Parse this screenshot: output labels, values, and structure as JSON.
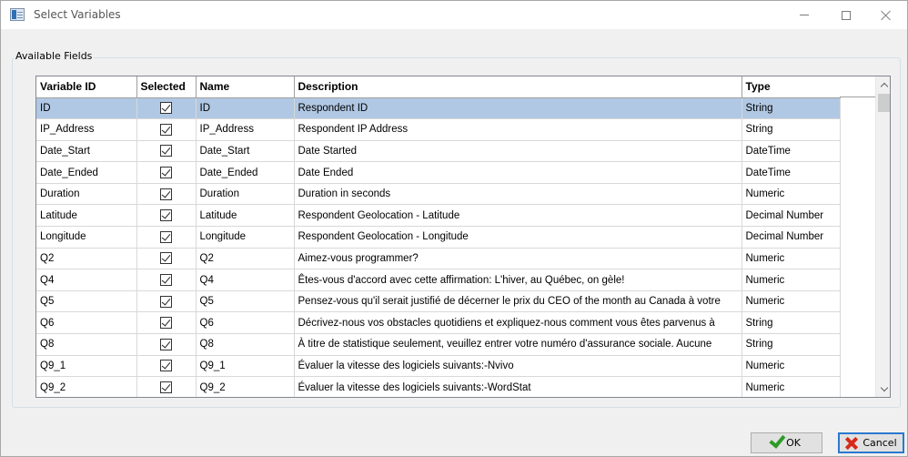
{
  "window": {
    "title": "Select Variables",
    "icon": "app-window-icon"
  },
  "group": {
    "label": "Available Fields"
  },
  "table": {
    "columns": [
      "Variable ID",
      "Selected",
      "Name",
      "Description",
      "Type"
    ],
    "rows": [
      {
        "variable_id": "ID",
        "selected": true,
        "name": "ID",
        "description": "Respondent ID",
        "type": "String"
      },
      {
        "variable_id": "IP_Address",
        "selected": true,
        "name": "IP_Address",
        "description": "Respondent IP Address",
        "type": "String"
      },
      {
        "variable_id": "Date_Start",
        "selected": true,
        "name": "Date_Start",
        "description": "Date Started",
        "type": "DateTime"
      },
      {
        "variable_id": "Date_Ended",
        "selected": true,
        "name": "Date_Ended",
        "description": "Date Ended",
        "type": "DateTime"
      },
      {
        "variable_id": "Duration",
        "selected": true,
        "name": "Duration",
        "description": "Duration in seconds",
        "type": "Numeric"
      },
      {
        "variable_id": "Latitude",
        "selected": true,
        "name": "Latitude",
        "description": "Respondent Geolocation - Latitude",
        "type": "Decimal Number"
      },
      {
        "variable_id": "Longitude",
        "selected": true,
        "name": "Longitude",
        "description": "Respondent Geolocation - Longitude",
        "type": "Decimal Number"
      },
      {
        "variable_id": "Q2",
        "selected": true,
        "name": "Q2",
        "description": "Aimez-vous programmer?",
        "type": "Numeric"
      },
      {
        "variable_id": "Q4",
        "selected": true,
        "name": "Q4",
        "description": "Êtes-vous d'accord avec cette affirmation: L'hiver, au Québec, on gèle!",
        "type": "Numeric"
      },
      {
        "variable_id": "Q5",
        "selected": true,
        "name": "Q5",
        "description": "Pensez-vous qu'il serait justifié de décerner le prix du CEO of the month au Canada à votre",
        "type": "Numeric"
      },
      {
        "variable_id": "Q6",
        "selected": true,
        "name": "Q6",
        "description": "Décrivez-nous vos obstacles quotidiens et expliquez-nous comment vous êtes parvenus à",
        "type": "String"
      },
      {
        "variable_id": "Q8",
        "selected": true,
        "name": "Q8",
        "description": "À titre de statistique seulement, veuillez entrer votre numéro d'assurance sociale. Aucune",
        "type": "String"
      },
      {
        "variable_id": "Q9_1",
        "selected": true,
        "name": "Q9_1",
        "description": "Évaluer la vitesse des logiciels suivants:-Nvivo",
        "type": "Numeric"
      },
      {
        "variable_id": "Q9_2",
        "selected": true,
        "name": "Q9_2",
        "description": "Évaluer la vitesse des logiciels suivants:-WordStat",
        "type": "Numeric"
      }
    ],
    "selected_row_index": 0,
    "selection_color": "#b0c8e4"
  },
  "buttons": {
    "ok_label": "OK",
    "cancel_label": "Cancel",
    "ok_icon": "green-check-icon",
    "cancel_icon": "red-x-icon"
  }
}
